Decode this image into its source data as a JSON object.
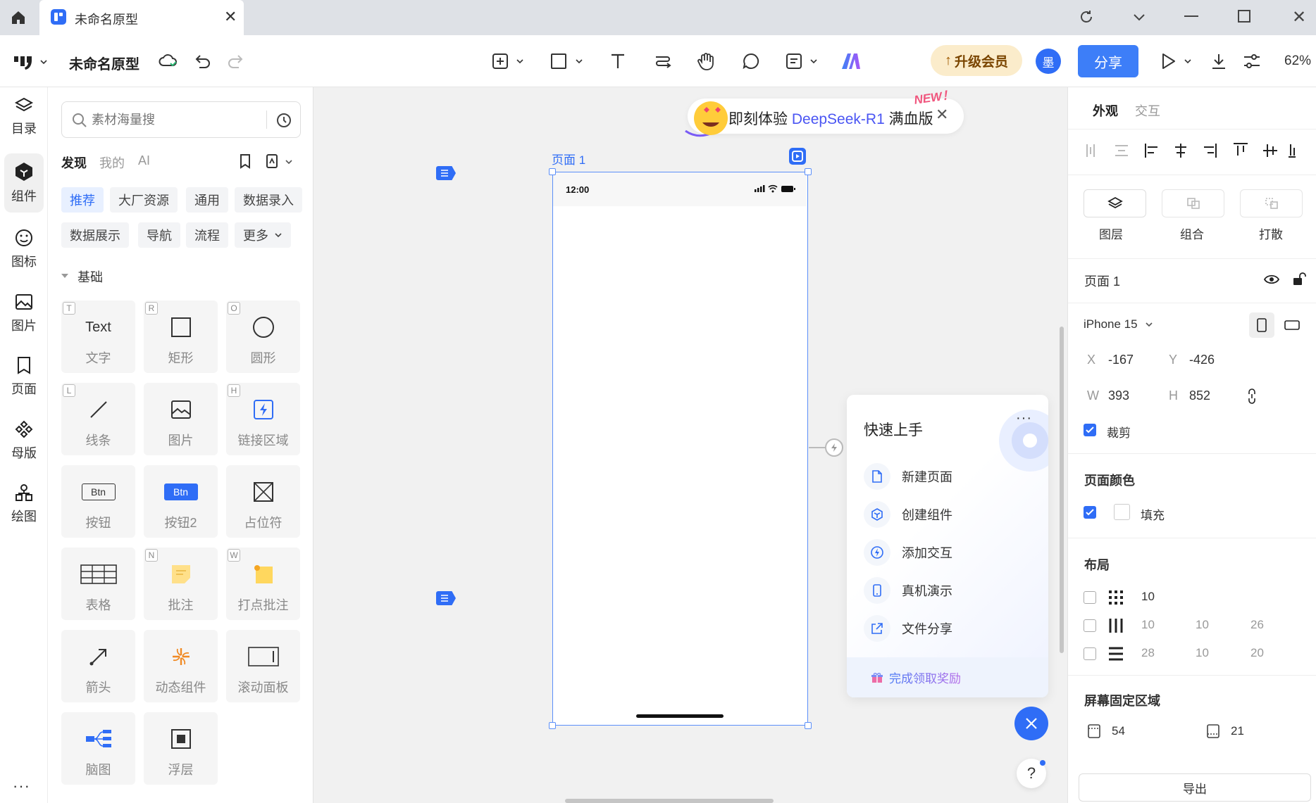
{
  "titlebar": {
    "tab_title": "未命名原型"
  },
  "toolbar": {
    "doc_title": "未命名原型",
    "upgrade_label": "升级会员",
    "avatar_initial": "墨",
    "share_label": "分享",
    "zoom": "62%"
  },
  "leftrail": {
    "items": [
      {
        "label": "目录",
        "icon": "layers-icon"
      },
      {
        "label": "组件",
        "icon": "component-icon"
      },
      {
        "label": "图标",
        "icon": "smile-icon"
      },
      {
        "label": "图片",
        "icon": "image-icon"
      },
      {
        "label": "页面",
        "icon": "bookmark-icon"
      },
      {
        "label": "母版",
        "icon": "master-icon"
      },
      {
        "label": "绘图",
        "icon": "shapes-icon"
      }
    ],
    "more": "···"
  },
  "panel": {
    "search_placeholder": "素材海量搜",
    "tabs": [
      "发现",
      "我的",
      "AI"
    ],
    "chips": [
      "推荐",
      "大厂资源",
      "通用",
      "数据录入",
      "数据展示",
      "导航",
      "流程",
      "更多"
    ],
    "section_title": "基础",
    "components": [
      {
        "label": "文字",
        "key": "T",
        "icon": "text-icon",
        "icon_text": "Text"
      },
      {
        "label": "矩形",
        "key": "R",
        "icon": "rectangle-icon"
      },
      {
        "label": "圆形",
        "key": "O",
        "icon": "circle-icon"
      },
      {
        "label": "线条",
        "key": "L",
        "icon": "line-icon"
      },
      {
        "label": "图片",
        "key": "",
        "icon": "image-icon"
      },
      {
        "label": "链接区域",
        "key": "H",
        "icon": "link-area-icon"
      },
      {
        "label": "按钮",
        "key": "",
        "icon": "button-icon",
        "icon_text": "Btn"
      },
      {
        "label": "按钮2",
        "key": "",
        "icon": "button2-icon",
        "icon_text": "Btn"
      },
      {
        "label": "占位符",
        "key": "",
        "icon": "placeholder-icon"
      },
      {
        "label": "表格",
        "key": "",
        "icon": "table-icon"
      },
      {
        "label": "批注",
        "key": "N",
        "icon": "note-icon"
      },
      {
        "label": "打点批注",
        "key": "W",
        "icon": "pin-note-icon"
      },
      {
        "label": "箭头",
        "key": "",
        "icon": "arrow-icon"
      },
      {
        "label": "动态组件",
        "key": "",
        "icon": "dynamic-icon"
      },
      {
        "label": "滚动面板",
        "key": "",
        "icon": "scroll-panel-icon"
      },
      {
        "label": "脑图",
        "key": "",
        "icon": "mindmap-icon"
      },
      {
        "label": "浮层",
        "key": "",
        "icon": "overlay-icon"
      }
    ]
  },
  "canvas": {
    "banner": {
      "prefix": "即刻体验 ",
      "highlight": "DeepSeek-R1",
      "suffix": " 满血版",
      "badge": "NEW！"
    },
    "page_label": "页面 1",
    "phone_time": "12:00",
    "quickstart": {
      "title": "快速上手",
      "more": "···",
      "items": [
        {
          "label": "新建页面",
          "icon": "file-icon"
        },
        {
          "label": "创建组件",
          "icon": "component-icon"
        },
        {
          "label": "添加交互",
          "icon": "bolt-icon"
        },
        {
          "label": "真机演示",
          "icon": "phone-icon"
        },
        {
          "label": "文件分享",
          "icon": "share-icon"
        }
      ],
      "reward": "完成领取奖励"
    },
    "help": "?"
  },
  "rightpanel": {
    "tabs": [
      "外观",
      "交互"
    ],
    "group_buttons": [
      "图层",
      "组合",
      "打散"
    ],
    "page_name": "页面 1",
    "device": "iPhone 15",
    "x_label": "X",
    "x": "-167",
    "y_label": "Y",
    "y": "-426",
    "w_label": "W",
    "w": "393",
    "h_label": "H",
    "h": "852",
    "clip_label": "裁剪",
    "page_color_title": "页面颜色",
    "fill_label": "填充",
    "layout_title": "布局",
    "layout_grid": "10",
    "layout_cols": [
      "10",
      "10",
      "26"
    ],
    "layout_rows": [
      "28",
      "10",
      "20"
    ],
    "fixed_title": "屏幕固定区域",
    "fixed_top": "54",
    "fixed_bottom": "21",
    "export_label": "导出"
  }
}
